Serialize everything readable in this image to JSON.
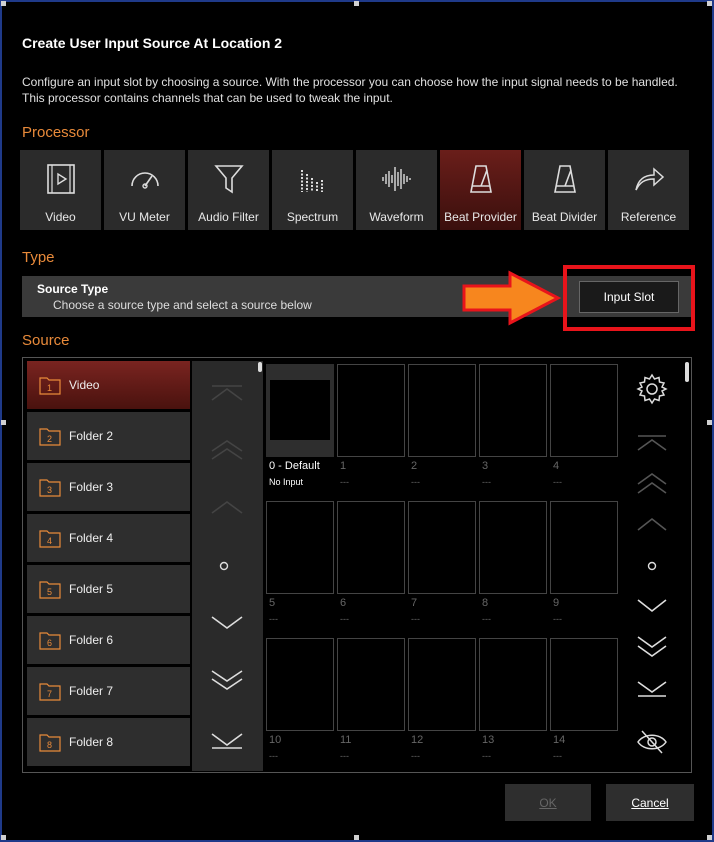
{
  "dialog": {
    "title": "Create User Input Source At Location 2",
    "description": "Configure an input slot by choosing a source. With the processor you can choose how the input signal needs to be handled. This processor contains channels that can be used to tweak the input."
  },
  "sections": {
    "processor": "Processor",
    "type": "Type",
    "source": "Source"
  },
  "processors": [
    {
      "label": "Video",
      "icon": "video-icon"
    },
    {
      "label": "VU Meter",
      "icon": "vu-meter-icon"
    },
    {
      "label": "Audio Filter",
      "icon": "funnel-icon"
    },
    {
      "label": "Spectrum",
      "icon": "spectrum-icon"
    },
    {
      "label": "Waveform",
      "icon": "waveform-icon"
    },
    {
      "label": "Beat Provider",
      "icon": "metronome-icon",
      "active": true
    },
    {
      "label": "Beat Divider",
      "icon": "metronome-icon"
    },
    {
      "label": "Reference",
      "icon": "forward-arrow-icon"
    }
  ],
  "type_bar": {
    "title": "Source Type",
    "subtitle": "Choose a source type and select a source below",
    "button": "Input Slot"
  },
  "folders": [
    {
      "num": "1",
      "label": "Video",
      "active": true
    },
    {
      "num": "2",
      "label": "Folder 2"
    },
    {
      "num": "3",
      "label": "Folder 3"
    },
    {
      "num": "4",
      "label": "Folder 4"
    },
    {
      "num": "5",
      "label": "Folder 5"
    },
    {
      "num": "6",
      "label": "Folder 6"
    },
    {
      "num": "7",
      "label": "Folder 7"
    },
    {
      "num": "8",
      "label": "Folder 8"
    }
  ],
  "slots": [
    {
      "num": "0 - Default",
      "sub": "No Input",
      "selected": true
    },
    {
      "num": "1",
      "sub": "---"
    },
    {
      "num": "2",
      "sub": "---"
    },
    {
      "num": "3",
      "sub": "---"
    },
    {
      "num": "4",
      "sub": "---"
    },
    {
      "num": "5",
      "sub": "---"
    },
    {
      "num": "6",
      "sub": "---"
    },
    {
      "num": "7",
      "sub": "---"
    },
    {
      "num": "8",
      "sub": "---"
    },
    {
      "num": "9",
      "sub": "---"
    },
    {
      "num": "10",
      "sub": "---"
    },
    {
      "num": "11",
      "sub": "---"
    },
    {
      "num": "12",
      "sub": "---"
    },
    {
      "num": "13",
      "sub": "---"
    },
    {
      "num": "14",
      "sub": "---"
    }
  ],
  "buttons": {
    "ok": "OK",
    "cancel": "Cancel"
  },
  "colors": {
    "accent": "#e88a3a",
    "active": "#6a1e1a",
    "highlight": "#e8141b",
    "arrow": "#f7861e",
    "window_border": "#1f3a8a"
  }
}
